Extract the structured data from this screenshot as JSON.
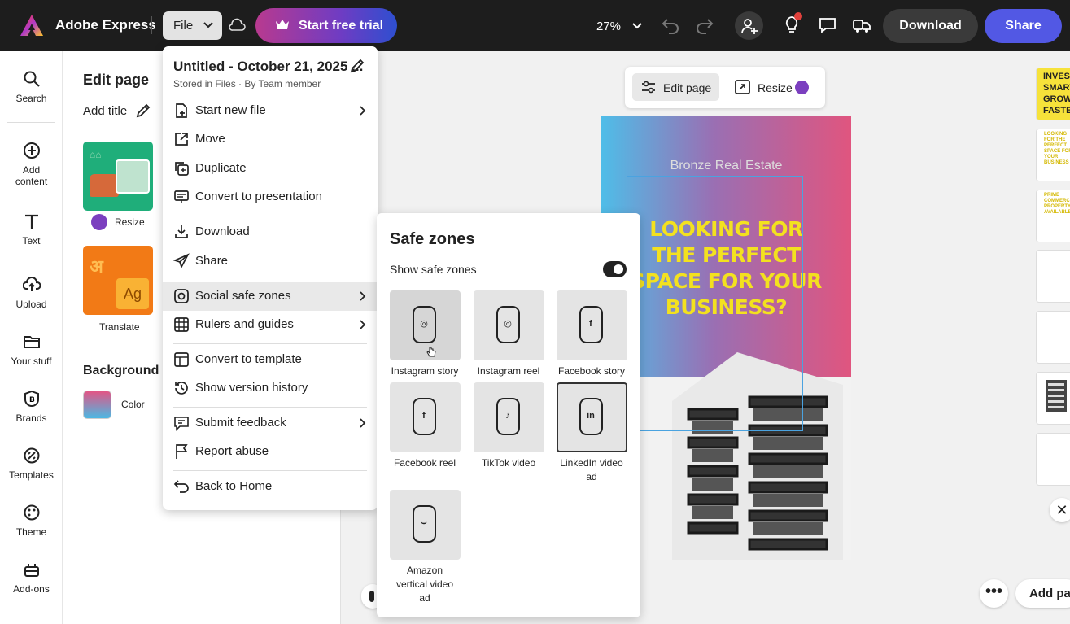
{
  "app": {
    "brand": "Adobe Express",
    "file_label": "File",
    "trial_label": "Start free trial",
    "zoom": "27%",
    "download_label": "Download",
    "share_label": "Share"
  },
  "rail": {
    "items": [
      {
        "label": "Search",
        "icon": "search-icon"
      },
      {
        "label": "Add content",
        "icon": "plus-circle-icon"
      },
      {
        "label": "Text",
        "icon": "text-icon"
      },
      {
        "label": "Upload",
        "icon": "upload-icon"
      },
      {
        "label": "Your stuff",
        "icon": "folder-icon"
      },
      {
        "label": "Brands",
        "icon": "brand-icon"
      },
      {
        "label": "Templates",
        "icon": "templates-icon"
      },
      {
        "label": "Theme",
        "icon": "palette-icon"
      },
      {
        "label": "Add-ons",
        "icon": "addons-icon"
      }
    ]
  },
  "panel": {
    "title": "Edit page",
    "add_title": "Add title",
    "resize_label": "Resize",
    "translate_label": "Translate",
    "background_title": "Background",
    "color_label": "Color"
  },
  "canvas": {
    "edit_page": "Edit page",
    "resize": "Resize",
    "poster_brand": "Bronze Real Estate",
    "poster_headline": [
      "LOOKING FOR",
      "THE PERFECT",
      "SPACE FOR YOUR",
      "BUSINESS?"
    ],
    "add_page": "Add page",
    "page_thumbs": [
      "INVEST SMART GROW FASTER",
      "LOOKING FOR THE PERFECT SPACE FOR YOUR BUSINESS",
      "PRIME COMMERCIAL PROPERTY AVAILABLE",
      "",
      "",
      "",
      ""
    ]
  },
  "file_menu": {
    "title": "Untitled - October 21, 2025 ...",
    "stored_in": "Stored in Files",
    "by": "By Team member",
    "items": [
      {
        "label": "Start new file",
        "icon": "new-file-icon"
      },
      {
        "label": "Move",
        "icon": "move-icon"
      },
      {
        "label": "Duplicate",
        "icon": "duplicate-icon"
      },
      {
        "label": "Convert to presentation",
        "icon": "presentation-icon"
      },
      {
        "label": "Download",
        "icon": "download-icon"
      },
      {
        "label": "Share",
        "icon": "share-icon"
      },
      {
        "label": "Social safe zones",
        "icon": "instagram-icon"
      },
      {
        "label": "Rulers and guides",
        "icon": "grid-icon"
      },
      {
        "label": "Convert to template",
        "icon": "template-icon"
      },
      {
        "label": "Show version history",
        "icon": "history-icon"
      },
      {
        "label": "Submit feedback",
        "icon": "feedback-icon"
      },
      {
        "label": "Report abuse",
        "icon": "flag-icon"
      },
      {
        "label": "Back to Home",
        "icon": "back-icon"
      }
    ]
  },
  "safe_zones": {
    "title": "Safe zones",
    "show_label": "Show safe zones",
    "show_enabled": true,
    "tiles": [
      {
        "label": "Instagram story",
        "icon": "instagram-icon",
        "glyph": "◎"
      },
      {
        "label": "Instagram reel",
        "icon": "instagram-icon",
        "glyph": "◎"
      },
      {
        "label": "Facebook story",
        "icon": "facebook-icon",
        "glyph": "f"
      },
      {
        "label": "Facebook reel",
        "icon": "facebook-icon",
        "glyph": "f"
      },
      {
        "label": "TikTok video",
        "icon": "tiktok-icon",
        "glyph": "♪"
      },
      {
        "label": "LinkedIn video ad",
        "icon": "linkedin-icon",
        "glyph": "in"
      },
      {
        "label": "Amazon vertical video ad",
        "icon": "amazon-icon",
        "glyph": "⌣"
      }
    ]
  },
  "colors": {
    "share": "#5258e4",
    "headline": "#f3e11f",
    "topbar": "#1d1d1d"
  }
}
